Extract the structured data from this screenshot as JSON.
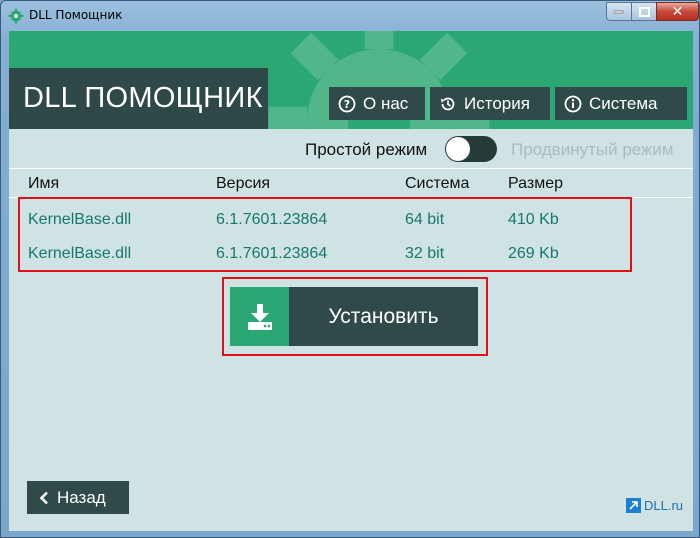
{
  "window": {
    "title": "DLL Помощник"
  },
  "header": {
    "brand": "DLL ПОМОЩНИК",
    "nav": [
      {
        "label": "О нас",
        "icon": "question-circle-icon"
      },
      {
        "label": "История",
        "icon": "history-icon"
      },
      {
        "label": "Система",
        "icon": "info-circle-icon"
      }
    ]
  },
  "mode": {
    "simple": "Простой режим",
    "advanced": "Продвинутый режим",
    "advanced_enabled": false
  },
  "table": {
    "columns": [
      "Имя",
      "Версия",
      "Система",
      "Размер"
    ],
    "rows": [
      {
        "name": "KernelBase.dll",
        "version": "6.1.7601.23864",
        "system": "64 bit",
        "size": "410 Kb"
      },
      {
        "name": "KernelBase.dll",
        "version": "6.1.7601.23864",
        "system": "32 bit",
        "size": "269 Kb"
      }
    ]
  },
  "install": {
    "label": "Установить",
    "icon": "download-icon"
  },
  "footer": {
    "back_label": "Назад",
    "site_label": "DLL.ru"
  },
  "colors": {
    "green": "#2aa772",
    "dark": "#2f4a49",
    "panel": "#cfe3e4",
    "link_teal": "#17776c",
    "highlight_red": "#e0101a"
  }
}
